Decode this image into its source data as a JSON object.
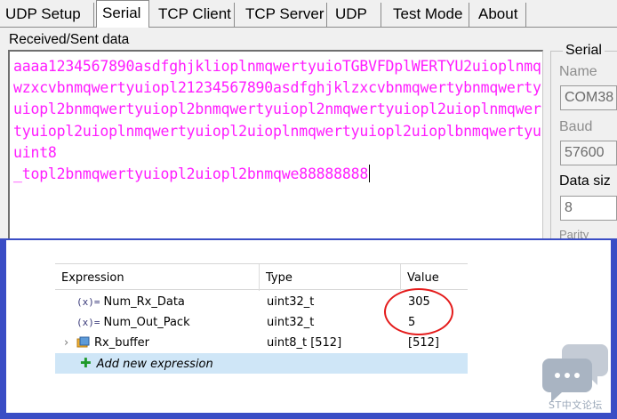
{
  "tabs": [
    {
      "label": "UDP Setup",
      "active": false
    },
    {
      "label": "Serial",
      "active": true
    },
    {
      "label": "TCP Client",
      "active": false
    },
    {
      "label": "TCP Server",
      "active": false
    },
    {
      "label": "UDP",
      "active": false
    },
    {
      "label": "Test Mode",
      "active": false
    },
    {
      "label": "About",
      "active": false
    }
  ],
  "received": {
    "label": "Received/Sent data",
    "text": "aaaa1234567890asdfghjklioplnmqwertyuioTGBVFDplWERTYU2uioplnmqwzxcvbnmqwertyuiopl21234567890asdfghjklzxcvbnmqwertybnmqwertyuiopl2bnmqwertyuiopl2bnmqwertyuiopl2nmqwertyuiopl2uioplnmqwertyuiopl2uioplnmqwertyuiopl2uioplnmqwertyuiopl2uioplbnmqwertyuuint8\n_topl2bnmqwertyuiopl2uiopl2bnmqwe88888888"
  },
  "serial_panel": {
    "title": "Serial",
    "name_label": "Name",
    "name_value": "COM38",
    "baud_label": "Baud",
    "baud_value": "57600",
    "datasize_label": "Data siz",
    "datasize_value": "8",
    "parity_label": "Parity"
  },
  "expressions": {
    "headers": {
      "expression": "Expression",
      "type": "Type",
      "value": "Value"
    },
    "rows": [
      {
        "icon": "(x)=",
        "name": "Num_Rx_Data",
        "type": "uint32_t",
        "value": "305"
      },
      {
        "icon": "(x)=",
        "name": "Num_Out_Pack",
        "type": "uint32_t",
        "value": "5"
      },
      {
        "icon": "struct",
        "name": "Rx_buffer",
        "type": "uint8_t [512]",
        "value": "[512]"
      }
    ],
    "add_label": "Add new expression"
  },
  "watermark": {
    "text": "ST中文论坛"
  },
  "colors": {
    "received_text": "#ff1dff",
    "frame": "#3a4dc5",
    "highlight_oval": "#e41b1b",
    "add_row": "#cfe6f7"
  }
}
